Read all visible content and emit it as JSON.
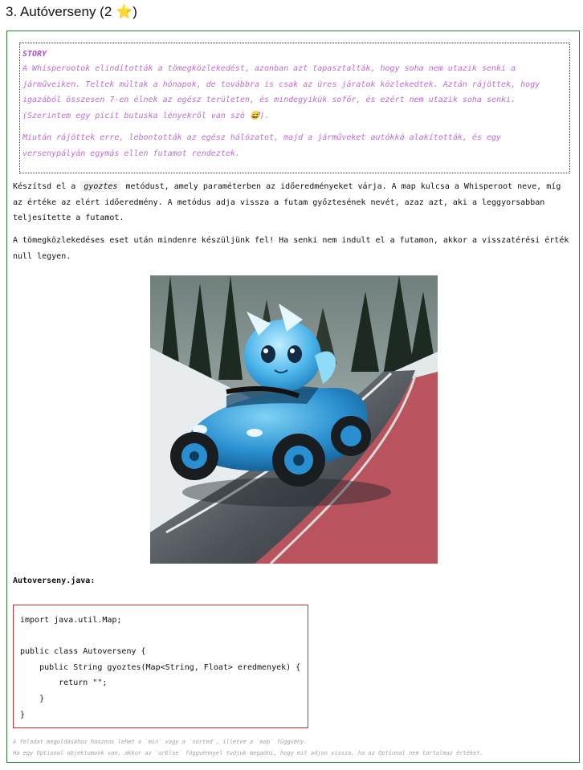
{
  "title": {
    "text": "3. Autóverseny (2",
    "star": "⭐",
    "close": ")"
  },
  "story": {
    "heading": "STORY",
    "paragraph1": "A Whisperootok elindították a tömegközlekedést, azonban azt tapasztalták, hogy soha nem utazik senki a járműveiken. Teltek múltak a hónapok, de továbbra is csak az üres járatok közlekedtek. Aztán rájöttek, hogy igazából összesen 7-en élnek az egész területen, és mindegyikük sofőr, és ezért nem utazik soha senki. (Szerintem egy picit butuska lényekről van szó 😅).",
    "paragraph2": "Miután rájöttek erre, lebontották az egész hálózatot, majd a járműveket autókká alakították, és egy versenypályán egymás ellen futamot rendeztek."
  },
  "task": {
    "prefix": "Készítsd el a",
    "method": "gyoztes",
    "suffix": "metódust, amely paraméterben az időeredményeket várja. A map kulcsa a Whisperoot neve, míg az értéke az elért időeredmény. A metódus adja vissza a futam győztesének nevét, azaz azt, aki a leggyorsabban teljesítette a futamot.",
    "second": "A tömegközlekedéses eset után mindenre készüljünk fel! Ha senki nem indult el a futamon, akkor a visszatérési érték null legyen."
  },
  "code": {
    "filename": "Autoverseny.java:",
    "lines": "import java.util.Map;\n\npublic class Autoverseny {\n    public String gyoztes(Map<String, Float> eredmenyek) {\n        return \"\";\n    }\n}"
  },
  "hints": {
    "line1": "A feladat megoldásához hasznos lehet a `min` vagy a `sorted`, illetve a `map` függvény.",
    "line2": "Ha egy Optional objektumunk van, akkor az `orElse` függvénnyel tudjuk megadni, hogy mit adjon vissza, ha az Optional nem tartalmaz értéket."
  },
  "colors": {
    "card_border": "#2e7d32",
    "story_text": "#c06ad8",
    "code_border": "#d32f2f"
  }
}
